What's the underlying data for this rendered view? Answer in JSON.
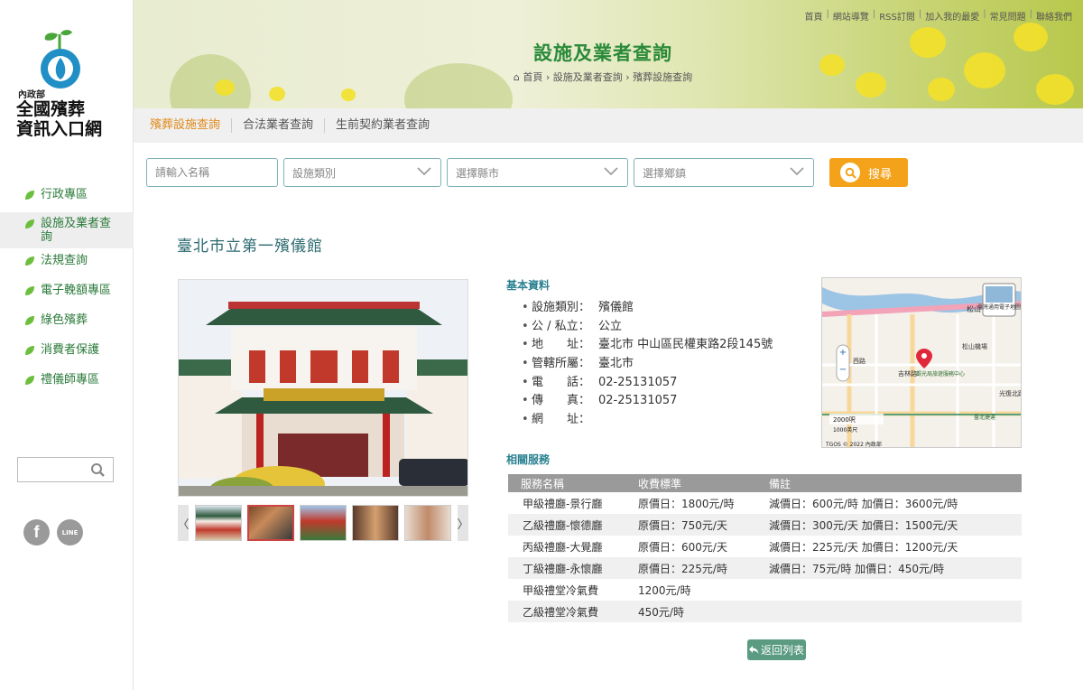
{
  "site": {
    "ministry": "內政部",
    "title_line1": "全國殯葬",
    "title_line2": "資訊入口網"
  },
  "sidebar": {
    "items": [
      {
        "label": "行政專區"
      },
      {
        "label": "設施及業者查詢",
        "active": true
      },
      {
        "label": "法規查詢"
      },
      {
        "label": "電子輓額專區"
      },
      {
        "label": "綠色殯葬"
      },
      {
        "label": "消費者保護"
      },
      {
        "label": "禮儀師專區"
      }
    ],
    "search_value": "",
    "social": {
      "facebook": "f",
      "line": "LINE"
    }
  },
  "header": {
    "top_links": [
      "首頁",
      "網站導覽",
      "RSS訂閱",
      "加入我的最愛",
      "常見問題",
      "聯絡我們"
    ],
    "page_title": "設施及業者查詢",
    "breadcrumb": [
      "首頁",
      "設施及業者查詢",
      "殯葬設施查詢"
    ]
  },
  "tabs": [
    {
      "label": "殯葬設施查詢",
      "active": true
    },
    {
      "label": "合法業者查詢"
    },
    {
      "label": "生前契約業者查詢"
    }
  ],
  "search": {
    "name_placeholder": "請輸入名稱",
    "type_select": "設施類別",
    "county_select": "選擇縣市",
    "town_select": "選擇鄉鎮",
    "button_label": "搜尋"
  },
  "facility": {
    "name": "臺北市立第一殯儀館",
    "basic_title": "基本資料",
    "info": [
      {
        "label": "設施類別：",
        "value": "殯儀館"
      },
      {
        "label": "公 / 私立：",
        "value": "公立"
      },
      {
        "label": "地　　址：",
        "value": "臺北市 中山區民權東路2段145號"
      },
      {
        "label": "管轄所屬：",
        "value": "臺北市"
      },
      {
        "label": "電　　話：",
        "value": "02-25131057"
      },
      {
        "label": "傳　　真：",
        "value": "02-25131057"
      },
      {
        "label": "網　　址：",
        "value": ""
      }
    ],
    "services_title": "相關服務",
    "service_headers": [
      "服務名稱",
      "收費標準",
      "備註"
    ],
    "services": [
      {
        "name": "甲級禮廳-景行廳",
        "fee": "原價日：1800元/時",
        "note": "減價日：600元/時 加價日：3600元/時"
      },
      {
        "name": "乙級禮廳-懷德廳",
        "fee": "原價日：750元/天",
        "note": "減價日：300元/天 加價日：1500元/天"
      },
      {
        "name": "丙級禮廳-大覺廳",
        "fee": "原價日：600元/天",
        "note": "減價日：225元/天 加價日：1200元/天"
      },
      {
        "name": "丁級禮廳-永懷廳",
        "fee": "原價日：225元/時",
        "note": "減價日：75元/時 加價日：450元/時"
      },
      {
        "name": "甲級禮堂冷氣費",
        "fee": "1200元/時",
        "note": ""
      },
      {
        "name": "乙級禮堂冷氣費",
        "fee": "450元/時",
        "note": ""
      }
    ],
    "back_label": "返回列表"
  },
  "map": {
    "labels": [
      "松山",
      "松山機場",
      "西路",
      "吉林路",
      "觀光局旅遊服務中心",
      "光復北路",
      "臺北捷運",
      "2000呎",
      "1000英尺",
      "TGOS © 2022 內政部"
    ],
    "badge": "臺灣通用電子地圖"
  },
  "colors": {
    "accent_green": "#2a8a3a",
    "accent_orange": "#f3a21a",
    "teal": "#2d6a70",
    "back_button": "#5a9b82"
  }
}
